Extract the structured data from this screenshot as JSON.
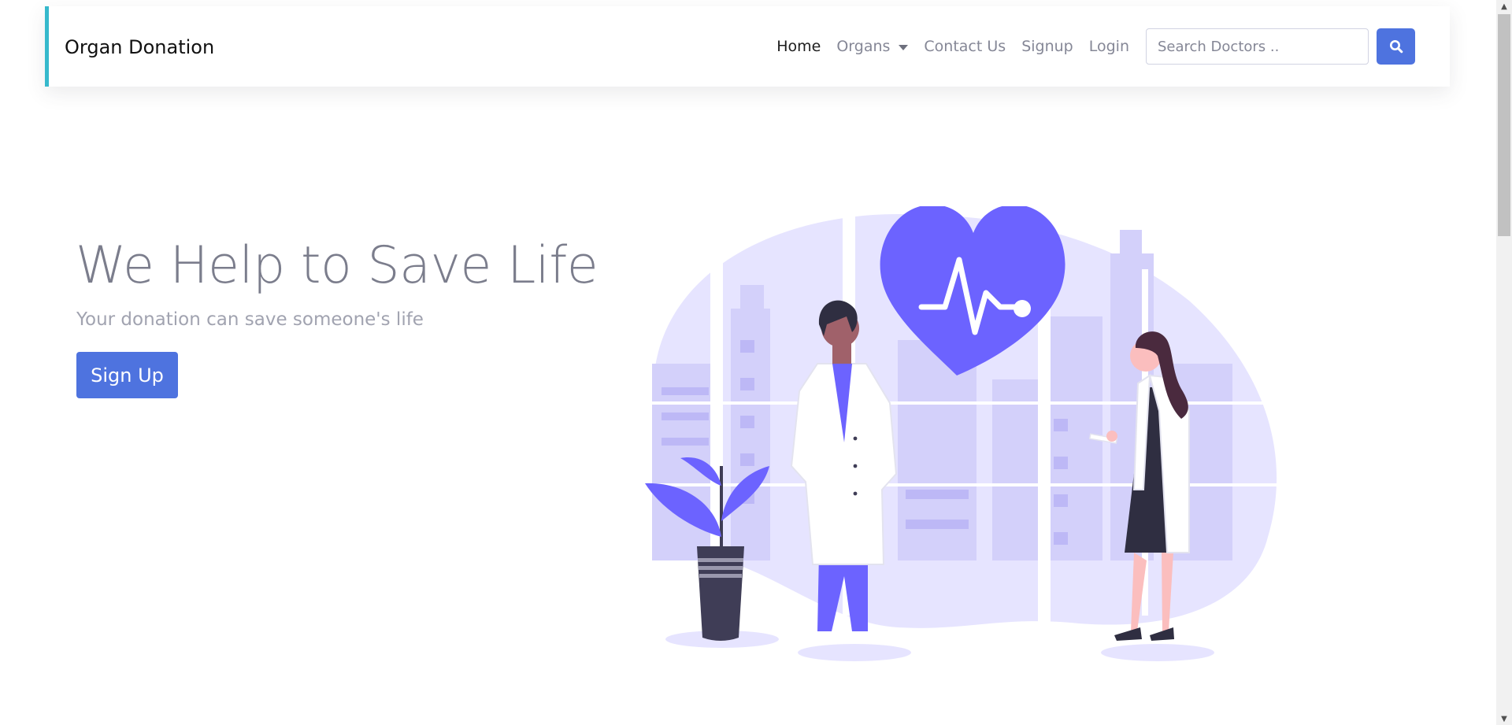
{
  "navbar": {
    "brand": "Organ Donation",
    "links": {
      "home": "Home",
      "organs": "Organs",
      "contact": "Contact Us",
      "signup": "Signup",
      "login": "Login"
    },
    "search": {
      "placeholder": "Search Doctors ..",
      "button_icon": "search-icon"
    }
  },
  "hero": {
    "title": "We Help to Save Life",
    "subtitle": "Your donation can save someone's life",
    "cta_label": "Sign Up"
  },
  "colors": {
    "primary": "#4e73df",
    "accent_border": "#36b9cc",
    "illustration_purple": "#6c63ff",
    "illustration_light": "#e6e4ff",
    "text_muted": "#858796"
  },
  "icons": {
    "heart": "heart-icon",
    "scroll_up": "chevron-up-icon",
    "scroll_down": "chevron-down-icon",
    "organs_caret": "caret-down-icon"
  }
}
